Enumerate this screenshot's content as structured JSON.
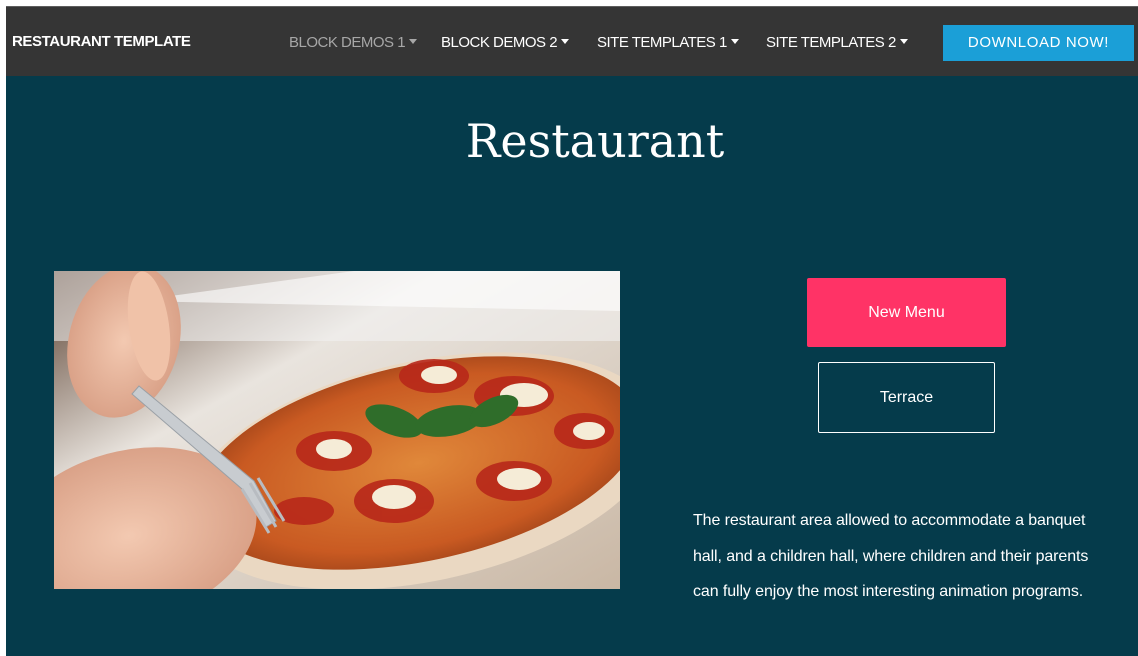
{
  "navbar": {
    "brand": "RESTAURANT TEMPLATE",
    "items": [
      {
        "label": "BLOCK DEMOS 1"
      },
      {
        "label": "BLOCK DEMOS 2"
      },
      {
        "label": "SITE TEMPLATES 1"
      },
      {
        "label": "SITE TEMPLATES 2"
      }
    ],
    "download_label": "DOWNLOAD NOW!"
  },
  "hero": {
    "title": "Restaurant"
  },
  "actions": {
    "primary_label": "New Menu",
    "secondary_label": "Terrace"
  },
  "description": "The restaurant area allowed to accommodate a banquet hall, and a children hall, where children and their parents can fully enjoy the most interesting animation programs.",
  "colors": {
    "navbar_bg": "#353535",
    "page_bg": "#053b4b",
    "download_button": "#1b9fd7",
    "primary_button": "#ff3366"
  },
  "icons": {
    "dropdown": "caret-down-icon"
  }
}
